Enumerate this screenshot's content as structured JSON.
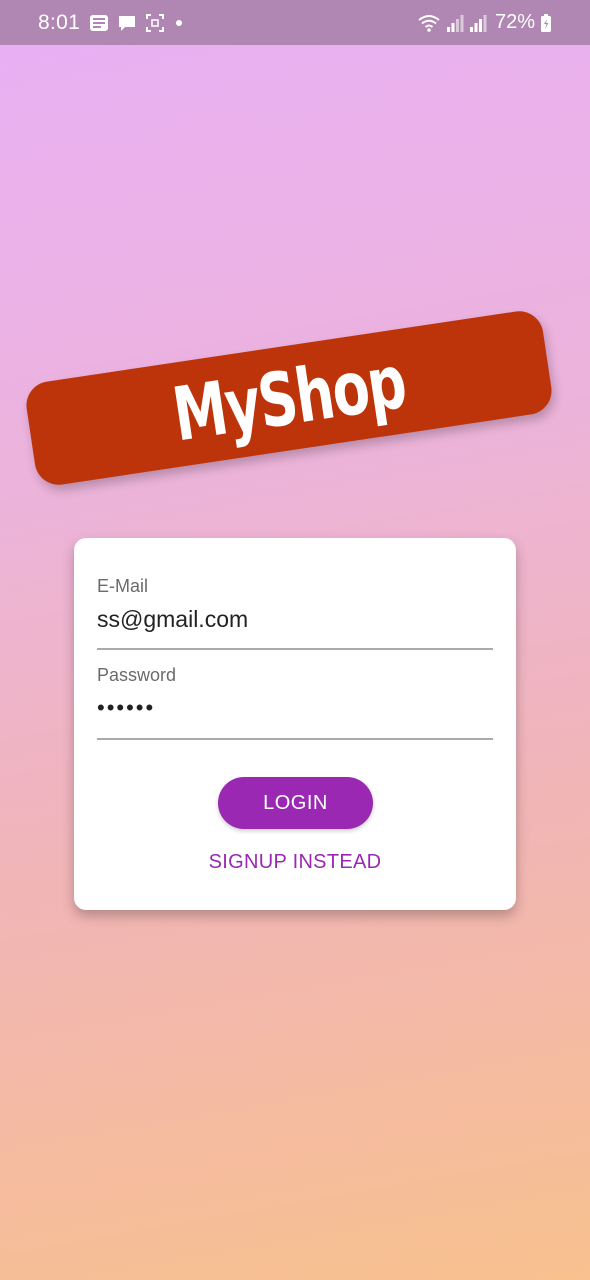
{
  "status_bar": {
    "time": "8:01",
    "battery": "72%",
    "left_icons": [
      "news-icon",
      "message-icon",
      "screenshot-icon",
      "dot-icon"
    ],
    "right_icons": [
      "wifi-icon",
      "signal-icon",
      "signal-icon",
      "battery-icon"
    ]
  },
  "logo": {
    "text": "MyShop",
    "color": "#bd340b"
  },
  "auth_form": {
    "email_label": "E-Mail",
    "email_value": "ss@gmail.com",
    "password_label": "Password",
    "password_value": "••••••",
    "login_button": "LOGIN",
    "signup_link": "SIGNUP INSTEAD",
    "accent_color": "#9a28b2"
  }
}
